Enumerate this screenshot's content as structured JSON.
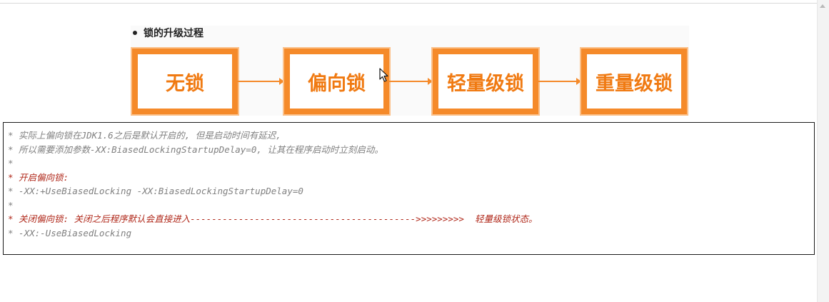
{
  "heading": "锁的升级过程",
  "stages": [
    "无锁",
    "偏向锁",
    "轻量级锁",
    "重量级锁"
  ],
  "code_lines": [
    {
      "text": "* 实际上偏向锁在JDK1.6之后是默认开启的, 但是启动时间有延迟,",
      "style": "comment"
    },
    {
      "text": "* 所以需要添加参数-XX:BiasedLockingStartupDelay=0, 让其在程序启动时立刻启动。",
      "style": "comment"
    },
    {
      "text": "*",
      "style": "comment"
    },
    {
      "text": "* 开启偏向锁:",
      "style": "highlight"
    },
    {
      "text": "* -XX:+UseBiasedLocking -XX:BiasedLockingStartupDelay=0",
      "style": "comment"
    },
    {
      "text": "*",
      "style": "comment"
    },
    {
      "text": "* 关闭偏向锁: 关闭之后程序默认会直接进入------------------------------------------>>>>>>>>>  轻量级锁状态。",
      "style": "highlight"
    },
    {
      "text": "* -XX:-UseBiasedLocking",
      "style": "comment"
    }
  ],
  "colors": {
    "accent": "#f58a2a",
    "comment": "#808080",
    "highlight": "#b0281a"
  },
  "icons": {
    "cursor": "mouse-pointer-icon",
    "scroll": "scroll-up-arrow-icon"
  }
}
